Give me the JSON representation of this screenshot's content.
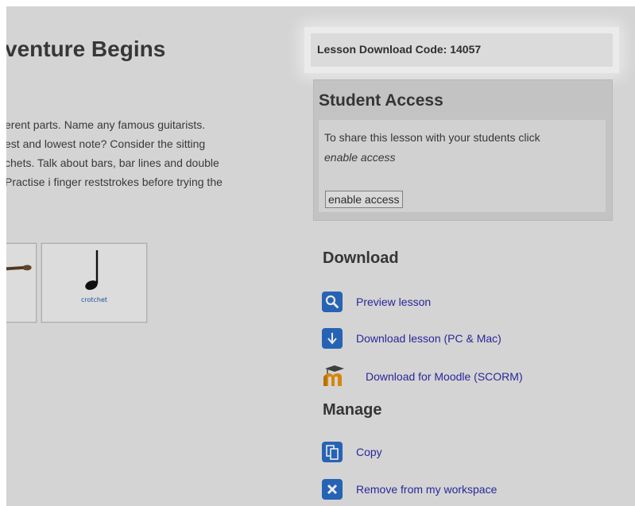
{
  "lesson": {
    "title": "venture Begins",
    "intro_lines": [
      "erent parts. Name any famous guitarists.",
      "est and lowest note? Consider the sitting",
      "chets. Talk about bars, bar lines and double",
      "Practise i finger reststrokes before trying the"
    ],
    "cards": [
      {
        "caption": "",
        "icon": "guitar-neck-icon"
      },
      {
        "caption": "crotchet",
        "icon": "crotchet-note-icon"
      }
    ]
  },
  "sidebar": {
    "download_code_label": "Lesson Download Code: 14057",
    "student_access": {
      "heading": "Student Access",
      "text": "To share this lesson with your students click",
      "text_emphasis": "enable access",
      "button_label": "enable access"
    },
    "download": {
      "heading": "Download",
      "links": [
        {
          "label": "Preview lesson",
          "icon": "search-icon"
        },
        {
          "label": "Download lesson (PC & Mac)",
          "icon": "download-arrow-icon"
        },
        {
          "label": "Download for Moodle (SCORM)",
          "icon": "moodle-icon"
        }
      ]
    },
    "manage": {
      "heading": "Manage",
      "links": [
        {
          "label": "Copy",
          "icon": "copy-icon"
        },
        {
          "label": "Remove from my workspace",
          "icon": "remove-icon"
        }
      ]
    }
  },
  "colors": {
    "background": "#e6e6e6",
    "link": "#2d2ba6",
    "icon_blue": "#2b6cc4",
    "moodle_orange": "#e8930c"
  }
}
